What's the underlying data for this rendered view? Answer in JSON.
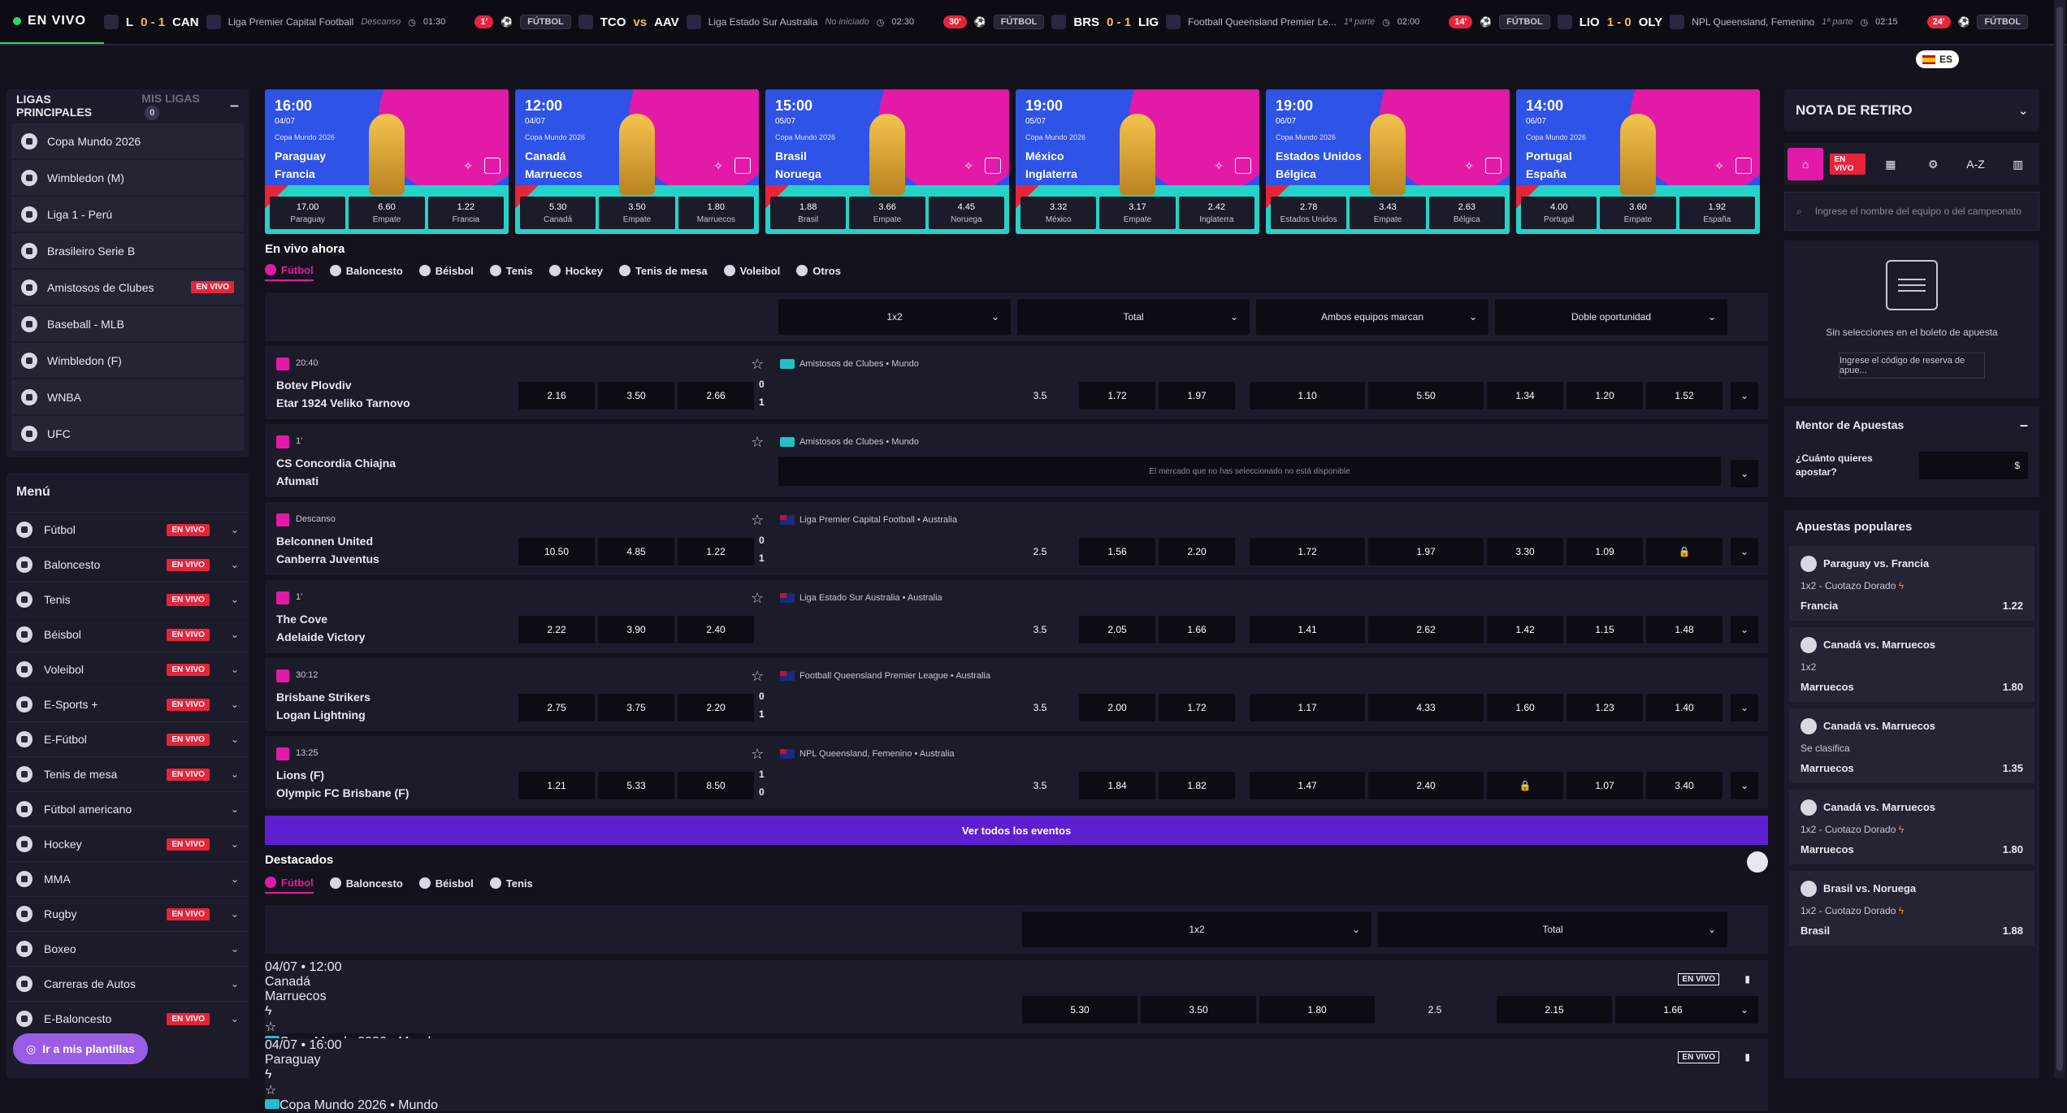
{
  "ticker": {
    "live_label": "EN VIVO",
    "items": [
      {
        "minute": "",
        "sport": "",
        "home": "L",
        "score": "0 - 1",
        "away": "CAN",
        "league": "Liga Premier Capital Football",
        "status": "Descanso",
        "time": "01:30"
      },
      {
        "minute": "1'",
        "sport": "FÚTBOL",
        "home": "TCO",
        "score": "vs",
        "away": "AAV",
        "league": "Liga Estado Sur Australia",
        "status": "No iniciado",
        "time": "02:30"
      },
      {
        "minute": "30'",
        "sport": "FÚTBOL",
        "home": "BRS",
        "score": "0 - 1",
        "away": "LIG",
        "league": "Football Queensland Premier Le...",
        "status": "1ª parte",
        "time": "02:00"
      },
      {
        "minute": "14'",
        "sport": "FÚTBOL",
        "home": "LIO",
        "score": "1 - 0",
        "away": "OLY",
        "league": "NPL Queensland, Femenino",
        "status": "1ª parte",
        "time": "02:15"
      },
      {
        "minute": "24'",
        "sport": "FÚTBOL",
        "home": "",
        "score": "",
        "away": "",
        "league": "",
        "status": "",
        "time": ""
      }
    ]
  },
  "language": "ES",
  "leagues": {
    "tab_main": "LIGAS PRINCIPALES",
    "tab_mine": "MIS LIGAS",
    "mine_count": "0",
    "items": [
      {
        "label": "Copa Mundo 2026",
        "badge": ""
      },
      {
        "label": "Wimbledon (M)",
        "badge": ""
      },
      {
        "label": "Liga 1 - Perú",
        "badge": ""
      },
      {
        "label": "Brasileiro Serie B",
        "badge": ""
      },
      {
        "label": "Amistosos de Clubes",
        "badge": "EN VIVO"
      },
      {
        "label": "Baseball - MLB",
        "badge": ""
      },
      {
        "label": "Wimbledon (F)",
        "badge": ""
      },
      {
        "label": "WNBA",
        "badge": ""
      },
      {
        "label": "UFC",
        "badge": ""
      }
    ]
  },
  "menu": {
    "title": "Menú",
    "items": [
      {
        "label": "Fútbol",
        "badge": "EN VIVO"
      },
      {
        "label": "Baloncesto",
        "badge": "EN VIVO"
      },
      {
        "label": "Tenis",
        "badge": "EN VIVO"
      },
      {
        "label": "Béisbol",
        "badge": "EN VIVO"
      },
      {
        "label": "Voleibol",
        "badge": "EN VIVO"
      },
      {
        "label": "E-Sports +",
        "badge": "EN VIVO"
      },
      {
        "label": "E-Fútbol",
        "badge": "EN VIVO"
      },
      {
        "label": "Tenis de mesa",
        "badge": "EN VIVO"
      },
      {
        "label": "Fútbol americano",
        "badge": ""
      },
      {
        "label": "Hockey",
        "badge": "EN VIVO"
      },
      {
        "label": "MMA",
        "badge": ""
      },
      {
        "label": "Rugby",
        "badge": "EN VIVO"
      },
      {
        "label": "Boxeo",
        "badge": ""
      },
      {
        "label": "Carreras de Autos",
        "badge": ""
      },
      {
        "label": "E-Baloncesto",
        "badge": "EN VIVO"
      }
    ],
    "templates_button": "Ir a mis plantillas"
  },
  "promo_cards": [
    {
      "time": "16:00",
      "date": "04/07",
      "competition": "Copa Mundo 2026",
      "team1": "Paraguay",
      "team2": "Francia",
      "odds": [
        {
          "v": "17.00",
          "l": "Paraguay"
        },
        {
          "v": "6.60",
          "l": "Empate"
        },
        {
          "v": "1.22",
          "l": "Francia"
        }
      ]
    },
    {
      "time": "12:00",
      "date": "04/07",
      "competition": "Copa Mundo 2026",
      "team1": "Canadá",
      "team2": "Marruecos",
      "odds": [
        {
          "v": "5.30",
          "l": "Canadá"
        },
        {
          "v": "3.50",
          "l": "Empate"
        },
        {
          "v": "1.80",
          "l": "Marruecos"
        }
      ]
    },
    {
      "time": "15:00",
      "date": "05/07",
      "competition": "Copa Mundo 2026",
      "team1": "Brasil",
      "team2": "Noruega",
      "odds": [
        {
          "v": "1.88",
          "l": "Brasil"
        },
        {
          "v": "3.66",
          "l": "Empate"
        },
        {
          "v": "4.45",
          "l": "Noruega"
        }
      ]
    },
    {
      "time": "19:00",
      "date": "05/07",
      "competition": "Copa Mundo 2026",
      "team1": "México",
      "team2": "Inglaterra",
      "odds": [
        {
          "v": "3.32",
          "l": "México"
        },
        {
          "v": "3.17",
          "l": "Empate"
        },
        {
          "v": "2.42",
          "l": "Inglaterra"
        }
      ]
    },
    {
      "time": "19:00",
      "date": "06/07",
      "competition": "Copa Mundo 2026",
      "team1": "Estados Unidos",
      "team2": "Bélgica",
      "odds": [
        {
          "v": "2.78",
          "l": "Estados Unidos"
        },
        {
          "v": "3.43",
          "l": "Empate"
        },
        {
          "v": "2.63",
          "l": "Bélgica"
        }
      ]
    },
    {
      "time": "14:00",
      "date": "06/07",
      "competition": "Copa Mundo 2026",
      "team1": "Portugal",
      "team2": "España",
      "odds": [
        {
          "v": "4.00",
          "l": "Portugal"
        },
        {
          "v": "3.60",
          "l": "Empate"
        },
        {
          "v": "1.92",
          "l": "España"
        }
      ]
    }
  ],
  "live": {
    "title": "En vivo ahora",
    "tabs": [
      "Fútbol",
      "Baloncesto",
      "Béisbol",
      "Tenis",
      "Hockey",
      "Tenis de mesa",
      "Voleibol",
      "Otros"
    ],
    "markets": [
      "1x2",
      "Total",
      "Ambos equipos marcan",
      "Doble oportunidad"
    ],
    "unavailable": "El mercado que no has seleccionado no está disponible",
    "matches": [
      {
        "time": "20:40",
        "competition": "Amistosos de Clubes • Mundo",
        "flag": "world",
        "team1": "Botev Plovdiv",
        "team2": "Etar 1924 Veliko Tarnovo",
        "s1": "0",
        "s2": "1",
        "odds": [
          "2.16",
          "3.50",
          "2.66"
        ],
        "line": "3.5",
        "totals": [
          "1.72",
          "1.97"
        ],
        "btts": [
          "1.10",
          "5.50"
        ],
        "dc": [
          "1.34",
          "1.20",
          "1.52"
        ]
      },
      {
        "time": "1'",
        "competition": "Amistosos de Clubes • Mundo",
        "flag": "world",
        "team1": "CS Concordia Chiajna",
        "team2": "Afumati",
        "s1": "",
        "s2": "",
        "unavailable": true
      },
      {
        "time": "Descanso",
        "competition": "Liga Premier Capital Football • Australia",
        "flag": "au",
        "team1": "Belconnen United",
        "team2": "Canberra Juventus",
        "s1": "0",
        "s2": "1",
        "odds": [
          "10.50",
          "4.85",
          "1.22"
        ],
        "line": "2.5",
        "totals": [
          "1.56",
          "2.20"
        ],
        "btts": [
          "1.72",
          "1.97"
        ],
        "dc": [
          "3.30",
          "1.09",
          "lock"
        ]
      },
      {
        "time": "1'",
        "competition": "Liga Estado Sur Australia • Australia",
        "flag": "au",
        "team1": "The Cove",
        "team2": "Adelaide Victory",
        "s1": "",
        "s2": "",
        "odds": [
          "2.22",
          "3.90",
          "2.40"
        ],
        "line": "3.5",
        "totals": [
          "2.05",
          "1.66"
        ],
        "btts": [
          "1.41",
          "2.62"
        ],
        "dc": [
          "1.42",
          "1.15",
          "1.48"
        ]
      },
      {
        "time": "30:12",
        "competition": "Football Queensland Premier League • Australia",
        "flag": "au",
        "team1": "Brisbane Strikers",
        "team2": "Logan Lightning",
        "s1": "0",
        "s2": "1",
        "odds": [
          "2.75",
          "3.75",
          "2.20"
        ],
        "line": "3.5",
        "totals": [
          "2.00",
          "1.72"
        ],
        "btts": [
          "1.17",
          "4.33"
        ],
        "dc": [
          "1.60",
          "1.23",
          "1.40"
        ]
      },
      {
        "time": "13:25",
        "competition": "NPL Queensland, Femenino • Australia",
        "flag": "au",
        "team1": "Lions (F)",
        "team2": "Olympic FC Brisbane (F)",
        "s1": "1",
        "s2": "0",
        "odds": [
          "1.21",
          "5.33",
          "8.50"
        ],
        "line": "3.5",
        "totals": [
          "1.84",
          "1.82"
        ],
        "btts": [
          "1.47",
          "2.40"
        ],
        "dc": [
          "lock",
          "1.07",
          "3.40"
        ]
      }
    ],
    "all_events": "Ver todos los eventos"
  },
  "featured": {
    "title": "Destacados",
    "tabs": [
      "Fútbol",
      "Baloncesto",
      "Béisbol",
      "Tenis"
    ],
    "markets": [
      "1x2",
      "Total"
    ],
    "matches": [
      {
        "time": "04/07 • 12:00",
        "competition": "Copa Mundo 2026 • Mundo",
        "team1": "Canadá",
        "team2": "Marruecos",
        "odds": [
          "5.30",
          "3.50",
          "1.80"
        ],
        "line": "2.5",
        "totals": [
          "2.15",
          "1.66"
        ],
        "live": "EN VIVO"
      },
      {
        "time": "04/07 • 16:00",
        "competition": "Copa Mundo 2026 • Mundo",
        "team1": "Paraguay",
        "team2": "",
        "odds": [],
        "line": "",
        "totals": [],
        "live": "EN VIVO"
      }
    ]
  },
  "right": {
    "withdraw_title": "NOTA DE RETIRO",
    "live_tab": "EN VIVO",
    "az_tab": "A-Z",
    "search_placeholder": "Ingrese el nombre del equipo o del campeonato",
    "empty_slip": "Sin selecciones en el boleto de apuesta",
    "booking_code": "Ingrese el código de reserva de apue...",
    "mentor_title": "Mentor de Apuestas",
    "mentor_question": "¿Cuánto quieres apostar?",
    "currency": "$",
    "popular_title": "Apuestas populares",
    "popular": [
      {
        "match": "Paraguay vs. Francia",
        "market": "1x2 - Cuotazo Dorado",
        "bolt": true,
        "pick": "Francia",
        "odd": "1.22"
      },
      {
        "match": "Canadá vs. Marruecos",
        "market": "1x2",
        "bolt": false,
        "pick": "Marruecos",
        "odd": "1.80"
      },
      {
        "match": "Canadá vs. Marruecos",
        "market": "Se clasifica",
        "bolt": false,
        "pick": "Marruecos",
        "odd": "1.35"
      },
      {
        "match": "Canadá vs. Marruecos",
        "market": "1x2 - Cuotazo Dorado",
        "bolt": true,
        "pick": "Marruecos",
        "odd": "1.80"
      },
      {
        "match": "Brasil vs. Noruega",
        "market": "1x2 - Cuotazo Dorado",
        "bolt": true,
        "pick": "Brasil",
        "odd": "1.88"
      }
    ]
  }
}
